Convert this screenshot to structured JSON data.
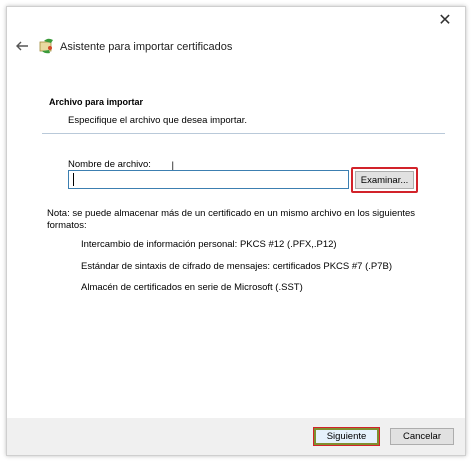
{
  "window": {
    "title": "Asistente para importar certificados",
    "close_glyph": "✕",
    "back_glyph": "←"
  },
  "section": {
    "title": "Archivo para importar",
    "description": "Especifique el archivo que desea importar."
  },
  "file": {
    "label": "Nombre de archivo:",
    "value": "",
    "browse_label": "Examinar..."
  },
  "note": {
    "text": "Nota: se puede almacenar más de un certificado en un mismo archivo en los siguientes formatos:",
    "formats": [
      "Intercambio de información personal: PKCS #12 (.PFX,.P12)",
      "Estándar de sintaxis de cifrado de mensajes: certificados PKCS #7 (.P7B)",
      "Almacén de certificados en serie de Microsoft (.SST)"
    ]
  },
  "footer": {
    "next_label": "Siguiente",
    "cancel_label": "Cancelar"
  },
  "colors": {
    "highlight": "#d2232a",
    "input_border": "#3c7fb1"
  },
  "icons": {
    "back": "back-arrow-icon",
    "wizard": "certificate-wizard-icon",
    "close": "close-icon",
    "cursor": "text-cursor-icon"
  }
}
